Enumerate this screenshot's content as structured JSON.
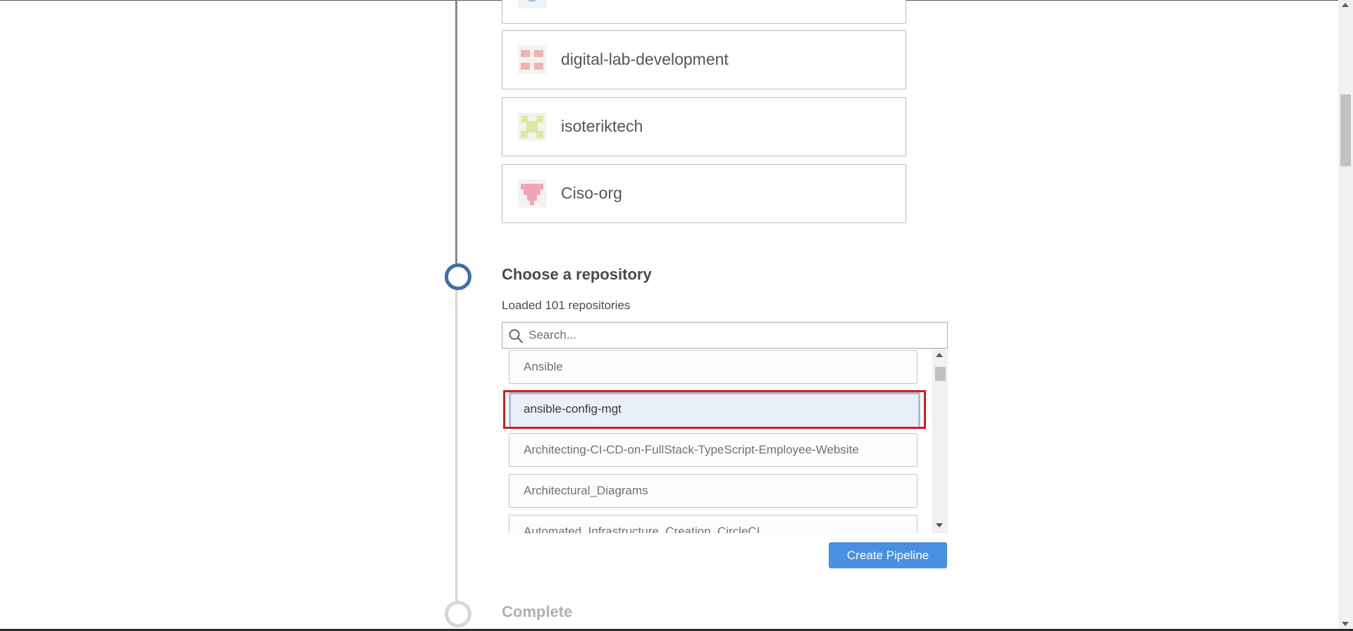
{
  "organizations": [
    {
      "name": "",
      "avatar": "partial-avatar-icon",
      "color": "#9cc3e0"
    },
    {
      "name": "digital-lab-development",
      "avatar": "identicon-avatar",
      "color": "#f0b3b3"
    },
    {
      "name": "isoteriktech",
      "avatar": "identicon-avatar",
      "color": "#dfe89a"
    },
    {
      "name": "Ciso-org",
      "avatar": "identicon-avatar",
      "color": "#f0a5b6"
    }
  ],
  "step_choose": {
    "title": "Choose a repository",
    "loaded_text": "Loaded 101 repositories",
    "search_placeholder": "Search...",
    "repositories": [
      {
        "name": "Ansible",
        "selected": false
      },
      {
        "name": "ansible-config-mgt",
        "selected": true
      },
      {
        "name": "Architecting-CI-CD-on-FullStack-TypeScript-Employee-Website",
        "selected": false
      },
      {
        "name": "Architectural_Diagrams",
        "selected": false
      },
      {
        "name": "Automated_Infrastructure_Creation_CircleCI",
        "selected": false
      }
    ],
    "create_button": "Create Pipeline"
  },
  "step_complete": {
    "title": "Complete"
  },
  "colors": {
    "accent": "#4a90e2",
    "active_step": "#3c6fa8",
    "highlight": "#d01f1f"
  }
}
